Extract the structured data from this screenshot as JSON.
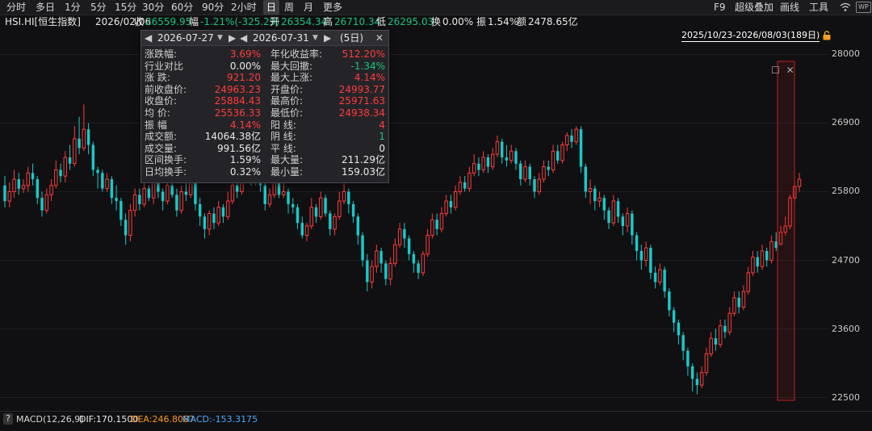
{
  "toolbar": {
    "left_tabs": [
      "分时",
      "多日",
      "1分",
      "5分",
      "15分",
      "30分",
      "60分",
      "90分",
      "2小时",
      "日",
      "周",
      "月",
      "更多"
    ],
    "active_tab": "日",
    "right_items": [
      "F9",
      "超级叠加",
      "画线",
      "工具"
    ]
  },
  "info": {
    "symbol": "HSI.HI[恒生指数]",
    "date": "2026/02/06",
    "close_label": "收",
    "close": "26559.95",
    "change_label": "幅",
    "change": "-1.21%(-325.29)",
    "open_label": "开",
    "open": "26354.34",
    "high_label": "高",
    "high": "26710.34",
    "low_label": "低",
    "low": "26295.03",
    "turnover_label": "换",
    "turnover": "0.00%",
    "amplitude_label": "振",
    "amplitude": "1.54%",
    "amount_label": "额",
    "amount": "2478.65亿"
  },
  "range_label": "2025/10/23-2026/08/03(189日)",
  "popup": {
    "start_date": "2026-07-27",
    "end_date": "2026-07-31",
    "days": "(5日)",
    "left": [
      {
        "label": "涨跌幅:",
        "value": "3.69%",
        "color": "red"
      },
      {
        "label": "行业对比",
        "value": "0.00%",
        "color": "white"
      },
      {
        "label": "涨 跌:",
        "value": "921.20",
        "color": "red"
      },
      {
        "label": "前收盘价:",
        "value": "24963.23",
        "color": "red"
      },
      {
        "label": "收盘价:",
        "value": "25884.43",
        "color": "red"
      },
      {
        "label": "均 价:",
        "value": "25536.33",
        "color": "red"
      },
      {
        "label": "振 幅",
        "value": "4.14%",
        "color": "red"
      },
      {
        "label": "成交额:",
        "value": "14064.38亿",
        "color": "white"
      },
      {
        "label": "成交量:",
        "value": "991.56亿",
        "color": "white"
      },
      {
        "label": "区间换手:",
        "value": "1.59%",
        "color": "white"
      },
      {
        "label": "日均换手:",
        "value": "0.32%",
        "color": "white"
      }
    ],
    "right": [
      {
        "label": "年化收益率:",
        "value": "512.20%",
        "color": "red"
      },
      {
        "label": "最大回撤:",
        "value": "-1.34%",
        "color": "green"
      },
      {
        "label": "最大上涨:",
        "value": "4.14%",
        "color": "red"
      },
      {
        "label": "开盘价:",
        "value": "24993.77",
        "color": "red"
      },
      {
        "label": "最高价:",
        "value": "25971.63",
        "color": "red"
      },
      {
        "label": "最低价:",
        "value": "24938.34",
        "color": "red"
      },
      {
        "label": "阳 线:",
        "value": "4",
        "color": "red"
      },
      {
        "label": "阴 线:",
        "value": "1",
        "color": "green"
      },
      {
        "label": "平 线:",
        "value": "0",
        "color": "white"
      },
      {
        "label": "最大量:",
        "value": "211.29亿",
        "color": "white"
      },
      {
        "label": "最小量:",
        "value": "159.03亿",
        "color": "white"
      }
    ]
  },
  "chart_data": {
    "type": "candlestick",
    "y_axis_labels": [
      "28000",
      "26900",
      "25800",
      "24700",
      "23600",
      "22500"
    ],
    "y_ticks": [
      28000,
      26900,
      25800,
      24700,
      23600,
      22500
    ],
    "ylim": [
      22300,
      28200
    ],
    "colors": {
      "up": "#ff3b3b",
      "down": "#19c9c9"
    },
    "candles": [
      [
        25900,
        25650,
        26050,
        25550
      ],
      [
        25650,
        25800,
        25950,
        25550
      ],
      [
        25800,
        26000,
        26150,
        25700
      ],
      [
        26000,
        25850,
        26100,
        25750
      ],
      [
        25850,
        25900,
        26000,
        25780
      ],
      [
        25900,
        26100,
        26200,
        25800
      ],
      [
        26100,
        26000,
        26250,
        25900
      ],
      [
        26000,
        25700,
        26050,
        25600
      ],
      [
        25700,
        25500,
        25800,
        25400
      ],
      [
        25500,
        25750,
        25850,
        25450
      ],
      [
        25750,
        25900,
        26000,
        25650
      ],
      [
        25900,
        26150,
        26300,
        25850
      ],
      [
        26150,
        26050,
        26250,
        25950
      ],
      [
        26050,
        26350,
        26450,
        25950
      ],
      [
        26350,
        26250,
        26550,
        26150
      ],
      [
        26250,
        26650,
        26850,
        26200
      ],
      [
        26650,
        26500,
        27000,
        26400
      ],
      [
        26500,
        26800,
        27200,
        26450
      ],
      [
        26800,
        26550,
        26900,
        26400
      ],
      [
        26550,
        26150,
        26600,
        26050
      ],
      [
        26150,
        26100,
        26200,
        25850
      ],
      [
        26100,
        25850,
        26150,
        25800
      ],
      [
        25850,
        26000,
        26100,
        25800
      ],
      [
        26000,
        25700,
        26050,
        25600
      ],
      [
        25700,
        25650,
        25900,
        25500
      ],
      [
        25650,
        25350,
        25700,
        25250
      ],
      [
        25350,
        25100,
        25450,
        24950
      ],
      [
        25100,
        25500,
        25600,
        25000
      ],
      [
        25500,
        25750,
        25850,
        25400
      ],
      [
        25750,
        25600,
        25850,
        25500
      ],
      [
        25600,
        25850,
        25950,
        25550
      ],
      [
        25850,
        25700,
        25900,
        25650
      ],
      [
        25700,
        25950,
        26050,
        25600
      ],
      [
        25950,
        25800,
        26000,
        25700
      ],
      [
        25800,
        25650,
        25850,
        25500
      ],
      [
        25650,
        25900,
        26000,
        25600
      ],
      [
        25900,
        25750,
        25950,
        25700
      ],
      [
        25750,
        25500,
        25850,
        25400
      ],
      [
        25500,
        25800,
        25900,
        25450
      ],
      [
        25800,
        25750,
        26050,
        25650
      ],
      [
        25750,
        25950,
        26100,
        25700
      ],
      [
        25950,
        25600,
        26000,
        25500
      ],
      [
        25600,
        25400,
        25700,
        25250
      ],
      [
        25400,
        25200,
        25450,
        25050
      ],
      [
        25200,
        25450,
        25500,
        25100
      ],
      [
        25450,
        25300,
        25550,
        25200
      ],
      [
        25300,
        25550,
        25650,
        25250
      ],
      [
        25550,
        25400,
        25600,
        25300
      ],
      [
        25400,
        25650,
        25800,
        25350
      ],
      [
        25650,
        25900,
        26000,
        25600
      ],
      [
        25900,
        25800,
        26050,
        25700
      ],
      [
        25800,
        26000,
        26200,
        25750
      ],
      [
        26000,
        26150,
        26300,
        25950
      ],
      [
        26150,
        25950,
        26250,
        25900
      ],
      [
        25950,
        26100,
        26200,
        25900
      ],
      [
        26100,
        25900,
        26200,
        25800
      ],
      [
        25900,
        25600,
        25950,
        25500
      ],
      [
        25600,
        25750,
        25850,
        25550
      ],
      [
        25750,
        25950,
        26050,
        25700
      ],
      [
        25950,
        25750,
        26000,
        25700
      ],
      [
        25750,
        25800,
        25950,
        25700
      ],
      [
        25800,
        25600,
        25850,
        25450
      ],
      [
        25600,
        25550,
        25700,
        25450
      ],
      [
        25550,
        25300,
        25600,
        25200
      ],
      [
        25300,
        25100,
        25400,
        25050
      ],
      [
        25100,
        25250,
        25300,
        25000
      ],
      [
        25250,
        25550,
        25700,
        25200
      ],
      [
        25550,
        25400,
        25600,
        25300
      ],
      [
        25400,
        25700,
        25800,
        25350
      ],
      [
        25700,
        25450,
        25750,
        25400
      ],
      [
        25450,
        25200,
        25500,
        25100
      ],
      [
        25200,
        25400,
        25450,
        25100
      ],
      [
        25400,
        25650,
        25800,
        25350
      ],
      [
        25650,
        25800,
        25950,
        25600
      ],
      [
        25800,
        25600,
        25850,
        25450
      ],
      [
        25600,
        25400,
        25650,
        25300
      ],
      [
        25400,
        25100,
        25450,
        24950
      ],
      [
        25100,
        24700,
        25150,
        24600
      ],
      [
        24700,
        24350,
        24800,
        24200
      ],
      [
        24350,
        24600,
        24700,
        24250
      ],
      [
        24600,
        24850,
        24950,
        24500
      ],
      [
        24850,
        24650,
        24900,
        24500
      ],
      [
        24650,
        24400,
        24700,
        24300
      ],
      [
        24400,
        24650,
        24750,
        24300
      ],
      [
        24650,
        24950,
        25050,
        24600
      ],
      [
        24950,
        25200,
        25300,
        24900
      ],
      [
        25200,
        25050,
        25300,
        24900
      ],
      [
        25050,
        24800,
        25100,
        24700
      ],
      [
        24800,
        24650,
        24850,
        24500
      ],
      [
        24650,
        24500,
        24700,
        24400
      ],
      [
        24500,
        24800,
        24850,
        24450
      ],
      [
        24800,
        25100,
        25200,
        24750
      ],
      [
        25100,
        25350,
        25450,
        25050
      ],
      [
        25350,
        25200,
        25450,
        25100
      ],
      [
        25200,
        25450,
        25550,
        25150
      ],
      [
        25450,
        25650,
        25750,
        25400
      ],
      [
        25650,
        25550,
        25750,
        25450
      ],
      [
        25550,
        25800,
        25900,
        25500
      ],
      [
        25800,
        25950,
        26050,
        25750
      ],
      [
        25950,
        25850,
        26050,
        25800
      ],
      [
        25850,
        26100,
        26200,
        25800
      ],
      [
        26100,
        26250,
        26400,
        26050
      ],
      [
        26250,
        26150,
        26350,
        26050
      ],
      [
        26150,
        26350,
        26450,
        26100
      ],
      [
        26350,
        26200,
        26400,
        26100
      ],
      [
        26200,
        26400,
        26500,
        26150
      ],
      [
        26400,
        26600,
        26700,
        26350
      ],
      [
        26600,
        26350,
        26650,
        26250
      ],
      [
        26350,
        26300,
        26550,
        26200
      ],
      [
        26300,
        26450,
        26550,
        26250
      ],
      [
        26450,
        26250,
        26500,
        26150
      ],
      [
        26250,
        26000,
        26300,
        25900
      ],
      [
        26000,
        26200,
        26300,
        25950
      ],
      [
        26200,
        26000,
        26250,
        25900
      ],
      [
        26000,
        25800,
        26050,
        25700
      ],
      [
        25800,
        26000,
        26100,
        25750
      ],
      [
        26000,
        26200,
        26300,
        25950
      ],
      [
        26200,
        26150,
        26300,
        26050
      ],
      [
        26150,
        26450,
        26550,
        26100
      ],
      [
        26450,
        26300,
        26550,
        26250
      ],
      [
        26300,
        26550,
        26600,
        26250
      ],
      [
        26550,
        26700,
        26750,
        26450
      ],
      [
        26700,
        26600,
        26800,
        26500
      ],
      [
        26600,
        26800,
        26850,
        26550
      ],
      [
        26800,
        26200,
        26850,
        26100
      ],
      [
        26200,
        25800,
        26250,
        25700
      ],
      [
        25800,
        25850,
        26000,
        25600
      ],
      [
        25850,
        25650,
        25900,
        25500
      ],
      [
        25650,
        25700,
        25800,
        25550
      ],
      [
        25700,
        25500,
        25750,
        25350
      ],
      [
        25500,
        25300,
        25550,
        25200
      ],
      [
        25300,
        25650,
        25750,
        25250
      ],
      [
        25650,
        25400,
        25700,
        25300
      ],
      [
        25400,
        25250,
        25450,
        25100
      ],
      [
        25250,
        25450,
        25550,
        25150
      ],
      [
        25450,
        25100,
        25500,
        24950
      ],
      [
        25100,
        24850,
        25150,
        24700
      ],
      [
        24850,
        24700,
        24950,
        24550
      ],
      [
        24700,
        24900,
        25000,
        24600
      ],
      [
        24900,
        24500,
        24950,
        24400
      ],
      [
        24500,
        24350,
        24600,
        24250
      ],
      [
        24350,
        24550,
        24650,
        24300
      ],
      [
        24550,
        24200,
        24600,
        24100
      ],
      [
        24200,
        23900,
        24250,
        23800
      ],
      [
        23900,
        23700,
        23950,
        23550
      ],
      [
        23700,
        23500,
        23750,
        23350
      ],
      [
        23500,
        23250,
        23550,
        23100
      ],
      [
        23250,
        23000,
        23300,
        22850
      ],
      [
        23000,
        22800,
        23050,
        22600
      ],
      [
        22800,
        22700,
        22900,
        22550
      ],
      [
        22700,
        22900,
        23000,
        22650
      ],
      [
        22900,
        23200,
        23300,
        22850
      ],
      [
        23200,
        23450,
        23550,
        23150
      ],
      [
        23450,
        23350,
        23600,
        23250
      ],
      [
        23350,
        23650,
        23750,
        23300
      ],
      [
        23650,
        23550,
        23750,
        23450
      ],
      [
        23550,
        23850,
        23950,
        23500
      ],
      [
        23850,
        24100,
        24200,
        23800
      ],
      [
        24100,
        23950,
        24200,
        23850
      ],
      [
        23950,
        24200,
        24300,
        23900
      ],
      [
        24200,
        24500,
        24600,
        24150
      ],
      [
        24500,
        24750,
        24850,
        24450
      ],
      [
        24750,
        24600,
        24850,
        24500
      ],
      [
        24600,
        24850,
        24950,
        24550
      ],
      [
        24850,
        24700,
        24900,
        24600
      ],
      [
        24700,
        25000,
        25100,
        24650
      ],
      [
        25000,
        24900,
        25150,
        24850
      ],
      [
        24963,
        25150,
        25250,
        24938
      ],
      [
        25150,
        25250,
        25400,
        25100
      ],
      [
        25250,
        25700,
        25750,
        25200
      ],
      [
        25700,
        25884,
        25972,
        25650
      ],
      [
        25884,
        26000,
        26100,
        25800
      ]
    ]
  },
  "macd": {
    "label": "MACD(12,26,9)",
    "dif": "DIF:170.1500",
    "dea": "DEA:246.8087",
    "macd": "MACD:-153.3175"
  },
  "help_icon": "?"
}
